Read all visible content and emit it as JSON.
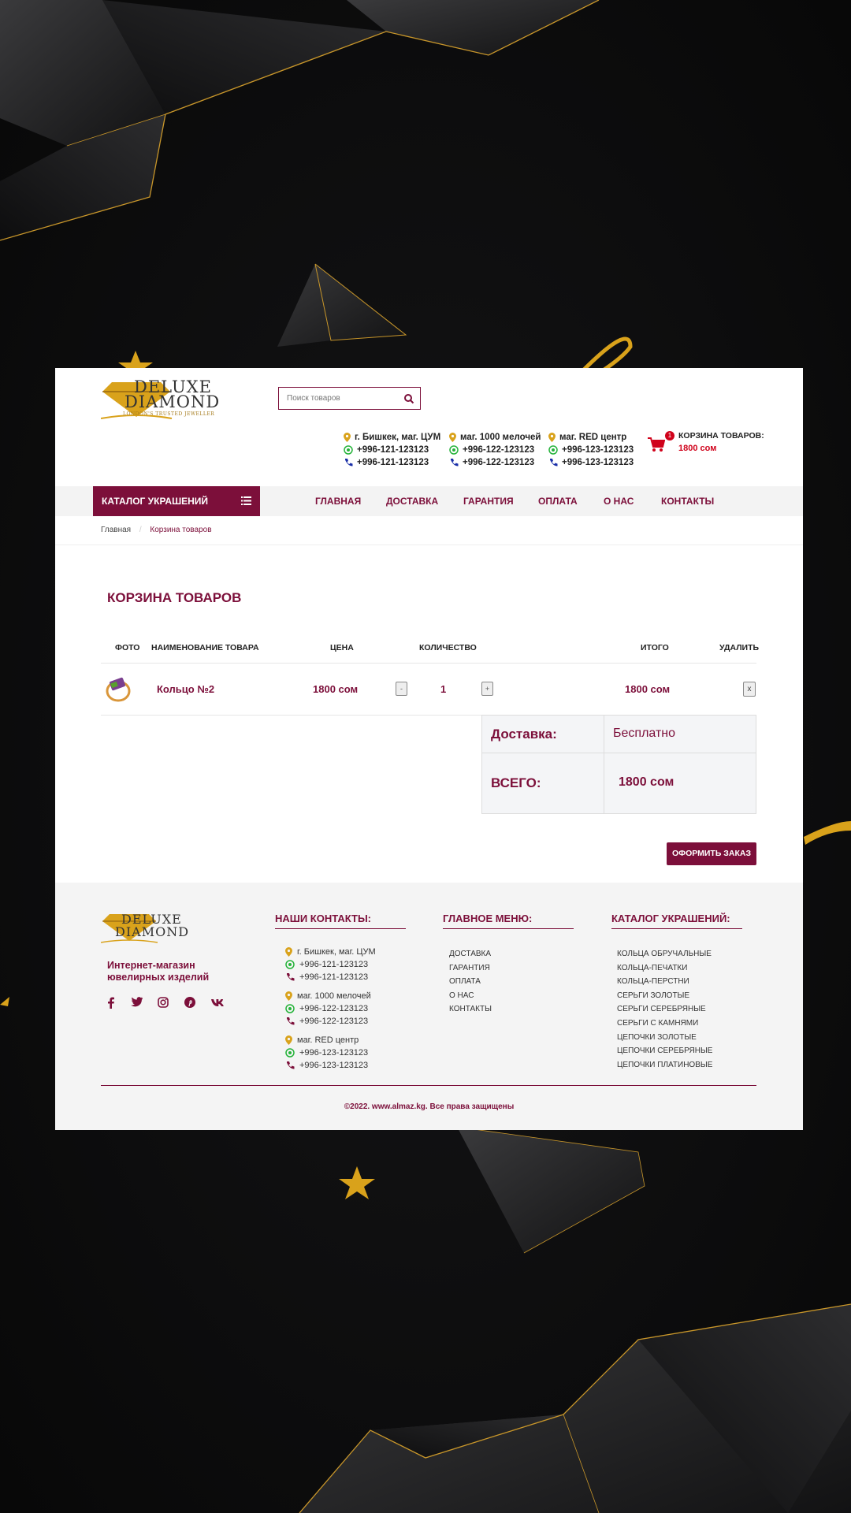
{
  "header": {
    "logo_line1": "DELUXE",
    "logo_line2": "DIAMOND",
    "logo_sub": "LONDON'S TRUSTED JEWELLER",
    "search_placeholder": "Поиск товаров",
    "contacts": [
      {
        "place": "г. Бишкек, маг. ЦУМ",
        "whatsapp": "+996-121-123123",
        "phone": "+996-121-123123"
      },
      {
        "place": "маг. 1000 мелочей",
        "whatsapp": "+996-122-123123",
        "phone": "+996-122-123123"
      },
      {
        "place": "маг. RED центр",
        "whatsapp": "+996-123-123123",
        "phone": "+996-123-123123"
      }
    ],
    "cart": {
      "badge": "1",
      "label": "КОРЗИНА ТОВАРОВ:",
      "sum": "1800 сом"
    }
  },
  "nav": {
    "catalog": "КАТАЛОГ УКРАШЕНИЙ",
    "items": [
      "ГЛАВНАЯ",
      "ДОСТАВКА",
      "ГАРАНТИЯ",
      "ОПЛАТА",
      "О НАС",
      "КОНТАКТЫ"
    ]
  },
  "breadcrumb": [
    "Главная",
    "/",
    "Корзина товаров"
  ],
  "cart_page": {
    "title": "КОРЗИНА ТОВАРОВ",
    "columns": [
      "ФОТО",
      "НАИМЕНОВАНИЕ ТОВАРА",
      "ЦЕНА",
      "КОЛИЧЕСТВО",
      "ИТОГО",
      "УДАЛИТЬ"
    ],
    "item": {
      "name": "Кольцо №2",
      "price": "1800 сом",
      "minus": "-",
      "qty": "1",
      "plus": "+",
      "total": "1800 сом",
      "delete": "x"
    },
    "delivery_label": "Доставка:",
    "delivery_value": "Бесплатно",
    "total_label": "ВСЕГО:",
    "total_value": "1800 сом",
    "order_button": "ОФОРМИТЬ ЗАКАЗ"
  },
  "footer": {
    "logo_line1": "DELUXE",
    "logo_line2": "DIAMOND",
    "tagline": "Интернет-магазин ювелирных изделий",
    "contacts_title": "НАШИ КОНТАКТЫ:",
    "menu_title": "ГЛАВНОЕ МЕНЮ:",
    "catalog_title": "КАТАЛОГ УКРАШЕНИЙ:",
    "contacts": [
      {
        "place": "г. Бишкек, маг. ЦУМ",
        "whatsapp": "+996-121-123123",
        "phone": "+996-121-123123"
      },
      {
        "place": "маг. 1000 мелочей",
        "whatsapp": "+996-122-123123",
        "phone": "+996-122-123123"
      },
      {
        "place": "маг. RED центр",
        "whatsapp": "+996-123-123123",
        "phone": "+996-123-123123"
      }
    ],
    "menu": [
      "ДОСТАВКА",
      "ГАРАНТИЯ",
      "ОПЛАТА",
      "О НАС",
      "КОНТАКТЫ"
    ],
    "catalog": [
      "КОЛЬЦА ОБРУЧАЛЬНЫЕ",
      "КОЛЬЦА-ПЕЧАТКИ",
      "КОЛЬЦА-ПЕРСТНИ",
      "СЕРЬГИ ЗОЛОТЫЕ",
      "СЕРЬГИ СЕРЕБРЯНЫЕ",
      "СЕРЬГИ С КАМНЯМИ",
      "ЦЕПОЧКИ ЗОЛОТЫЕ",
      "ЦЕПОЧКИ СЕРЕБРЯНЫЕ",
      "ЦЕПОЧКИ ПЛАТИНОВЫЕ"
    ],
    "social_icons": [
      "facebook-icon",
      "twitter-icon",
      "instagram-icon",
      "pinterest-icon",
      "vk-icon"
    ],
    "copyright": "©2022. www.almaz.kg. Все права защищены"
  },
  "colors": {
    "accent": "#7c0f3a",
    "gold": "#d9a21b",
    "cart_red": "#d0021b",
    "whatsapp": "#25b33a",
    "phone": "#1a2fa8"
  }
}
